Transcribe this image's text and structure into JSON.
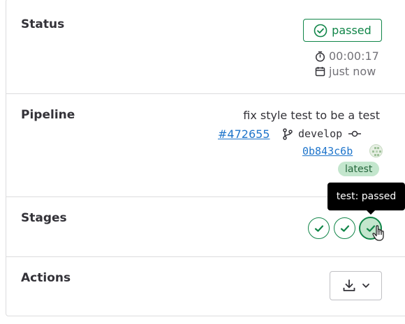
{
  "status": {
    "label": "Status",
    "badge_text": "passed",
    "duration": "00:00:17",
    "finished": "just now",
    "badge_color": "#108548"
  },
  "pipeline": {
    "label": "Pipeline",
    "commit_title": "fix style test to be a test",
    "pipeline_id": "#472655",
    "branch": "develop",
    "commit_sha": "0b843c6b",
    "latest_badge": "latest"
  },
  "stages": {
    "label": "Stages",
    "items": [
      {
        "status": "passed",
        "icon": "check-icon"
      },
      {
        "status": "passed",
        "icon": "check-icon"
      },
      {
        "status": "passed",
        "icon": "check-icon",
        "hovered": true
      }
    ],
    "tooltip": "test: passed"
  },
  "actions": {
    "label": "Actions",
    "button_icons": [
      "download-icon",
      "chevron-down-icon"
    ]
  }
}
